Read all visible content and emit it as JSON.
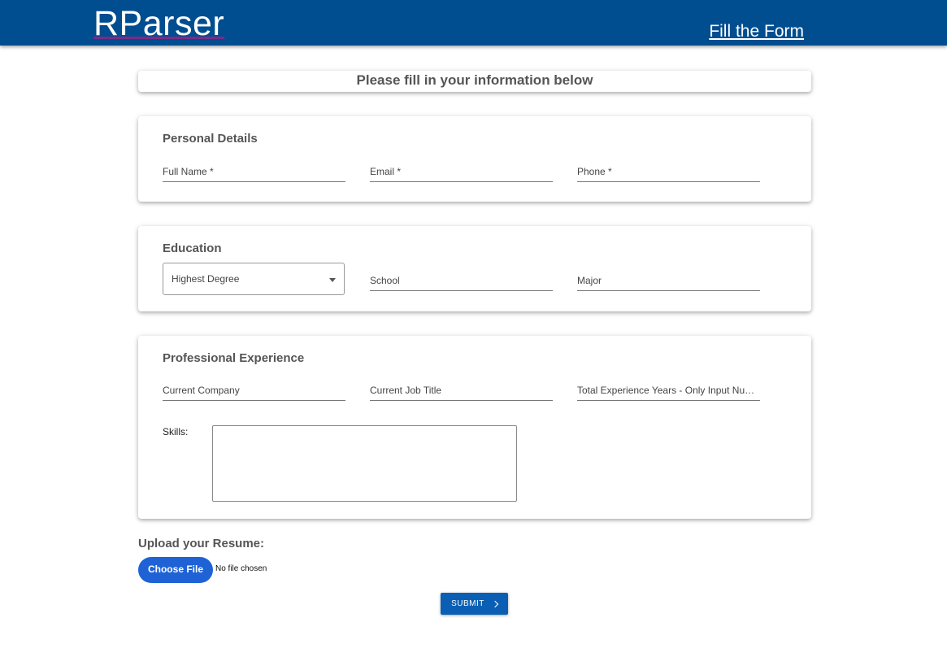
{
  "header": {
    "brand": "RParser",
    "nav_link": "Fill the Form"
  },
  "form_title": "Please fill in your information below",
  "personal": {
    "title": "Personal Details",
    "full_name": "Full Name *",
    "email": "Email *",
    "phone": "Phone *"
  },
  "education": {
    "title": "Education",
    "degree": "Highest Degree",
    "school": "School",
    "major": "Major"
  },
  "experience": {
    "title": "Professional Experience",
    "company": "Current Company",
    "job_title": "Current Job Title",
    "years": "Total Experience Years - Only Input Nu…",
    "skills_label": "Skills:"
  },
  "upload": {
    "label": "Upload your Resume:",
    "choose": "Choose File",
    "status": "No file chosen"
  },
  "submit_label": "SUBMIT",
  "colors": {
    "header_bg": "#004d8f",
    "choose_btn": "#1e62d6",
    "submit_btn": "#0a5fb4"
  }
}
